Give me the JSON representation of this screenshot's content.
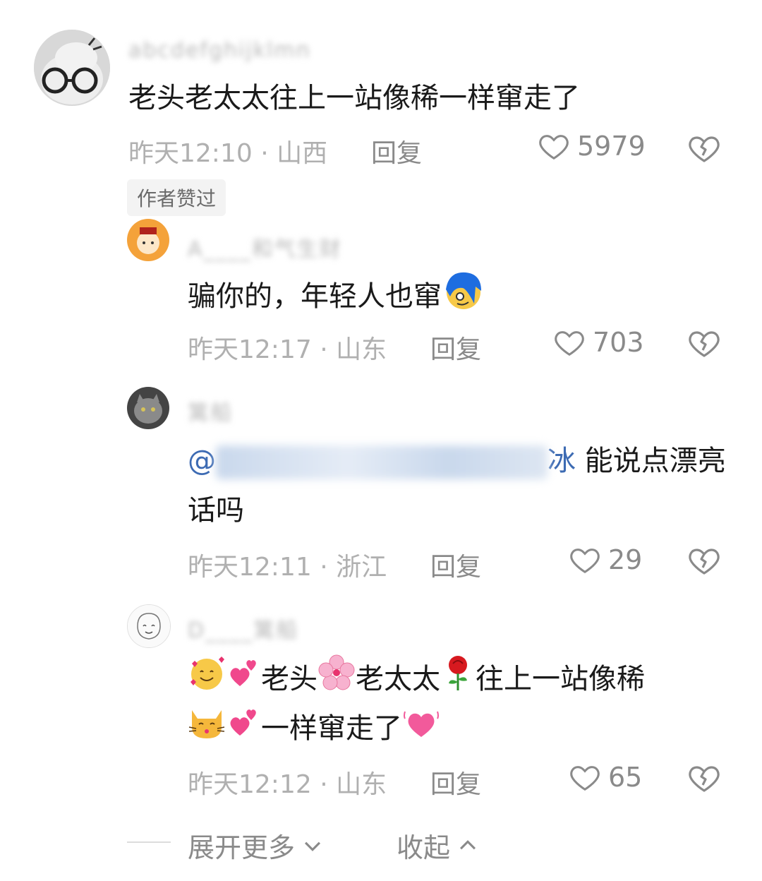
{
  "comments": [
    {
      "username": "abcdefghijklmn",
      "text": "老头老太太往上一站像稀一样窜走了",
      "meta": "昨天12:10 · 山西",
      "reply": "回复",
      "likes": "5979",
      "badge": "作者赞过"
    },
    {
      "username": "A____和气生财",
      "text": "骗你的，年轻人也窜",
      "meta": "昨天12:17 · 山东",
      "reply": "回复",
      "likes": "703"
    },
    {
      "username": "篱船",
      "mention_at": "@",
      "mention_suffix": "冰",
      "text_rest": "能说点漂亮",
      "text_line2": "话吗",
      "meta": "昨天12:11 · 浙江",
      "reply": "回复",
      "likes": "29"
    },
    {
      "username": "D____篱船",
      "text_p1": "老头",
      "text_p2": "老太太",
      "text_p3": "往上一站像稀",
      "text_p4": "一样窜走了",
      "meta": "昨天12:12 · 山东",
      "reply": "回复",
      "likes": "65"
    }
  ],
  "footer": {
    "expand": "展开更多",
    "collapse": "收起"
  }
}
